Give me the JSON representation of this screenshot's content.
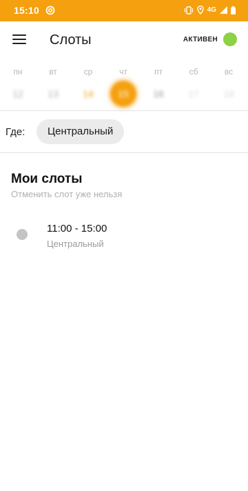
{
  "status_bar": {
    "time": "15:10",
    "network": "4G",
    "app_icon": "notification-at-icon",
    "icons": [
      "vibrate-icon",
      "location-icon",
      "signal-icon",
      "battery-icon"
    ],
    "background": "#F5A00F"
  },
  "app_bar": {
    "title": "Слоты",
    "status_label": "АКТИВЕН",
    "status_color": "#8DD146"
  },
  "week": {
    "days": [
      {
        "label": "пн",
        "number": "12",
        "state": "past"
      },
      {
        "label": "вт",
        "number": "13",
        "state": "past"
      },
      {
        "label": "ср",
        "number": "14",
        "state": "orange"
      },
      {
        "label": "чт",
        "number": "15",
        "state": "selected"
      },
      {
        "label": "пт",
        "number": "16",
        "state": "normal"
      },
      {
        "label": "сб",
        "number": "17",
        "state": "light"
      },
      {
        "label": "вс",
        "number": "18",
        "state": "light"
      }
    ]
  },
  "filter": {
    "where_label": "Где:",
    "location": "Центральный"
  },
  "my_slots": {
    "title": "Мои слоты",
    "subtitle": "Отменить слот уже нельзя",
    "items": [
      {
        "time": "11:00 - 15:00",
        "location": "Центральный"
      }
    ]
  }
}
